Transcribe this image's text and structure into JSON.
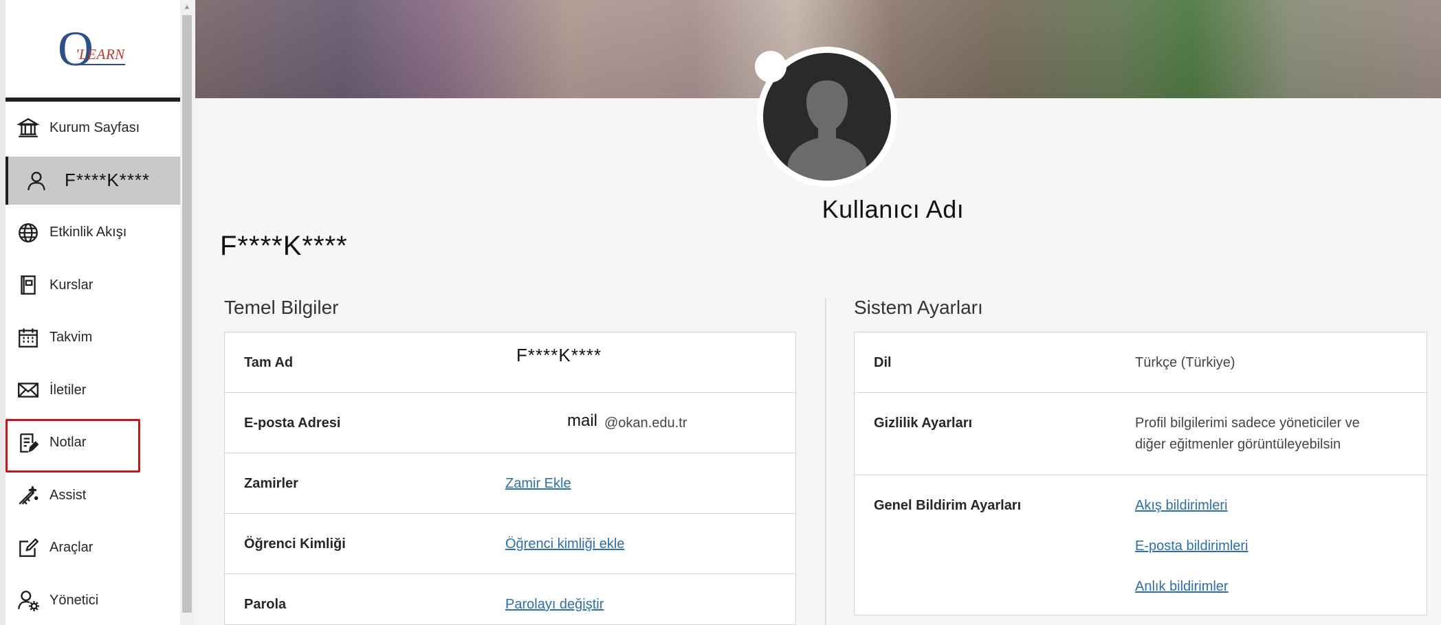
{
  "sidebar": {
    "items": [
      {
        "label": "Kurum Sayfası",
        "icon": "institution-icon"
      },
      {
        "label": "F****K****",
        "icon": "user-icon"
      },
      {
        "label": "Etkinlik Akışı",
        "icon": "globe-icon"
      },
      {
        "label": "Kurslar",
        "icon": "book-icon"
      },
      {
        "label": "Takvim",
        "icon": "calendar-icon"
      },
      {
        "label": "İletiler",
        "icon": "envelope-icon"
      },
      {
        "label": "Notlar",
        "icon": "grades-icon"
      },
      {
        "label": "Assist",
        "icon": "assist-icon"
      },
      {
        "label": "Araçlar",
        "icon": "tools-icon"
      },
      {
        "label": "Yönetici",
        "icon": "admin-icon"
      }
    ]
  },
  "logo": {
    "o": "O",
    "learn": "'LEARN"
  },
  "profile": {
    "display_name": "Kullanıcı Adı",
    "user_name": "F****K****"
  },
  "basic_info": {
    "title": "Temel Bilgiler",
    "rows": [
      {
        "label": "Tam Ad",
        "value": "F****K****"
      },
      {
        "label": "E-posta Adresi",
        "value_user": "mail",
        "value_domain": "@okan.edu.tr"
      },
      {
        "label": "Zamirler",
        "link": "Zamir Ekle"
      },
      {
        "label": "Öğrenci Kimliği",
        "link": "Öğrenci kimliği ekle"
      },
      {
        "label": "Parola",
        "link": "Parolayı değiştir"
      }
    ]
  },
  "system_settings": {
    "title": "Sistem Ayarları",
    "rows": [
      {
        "label": "Dil",
        "value": "Türkçe (Türkiye)"
      },
      {
        "label": "Gizlilik Ayarları",
        "value_line1": "Profil bilgilerimi sadece yöneticiler ve",
        "value_line2": "diğer eğitmenler görüntüleyebilsin"
      },
      {
        "label": "Genel Bildirim Ayarları",
        "links": [
          "Akış bildirimleri",
          "E-posta bildirimleri",
          "Anlık bildirimler"
        ]
      }
    ]
  },
  "colors": {
    "accent_link": "#2d6fad",
    "highlight_border": "#c0161c",
    "active_nav": "#c9c9c9"
  }
}
